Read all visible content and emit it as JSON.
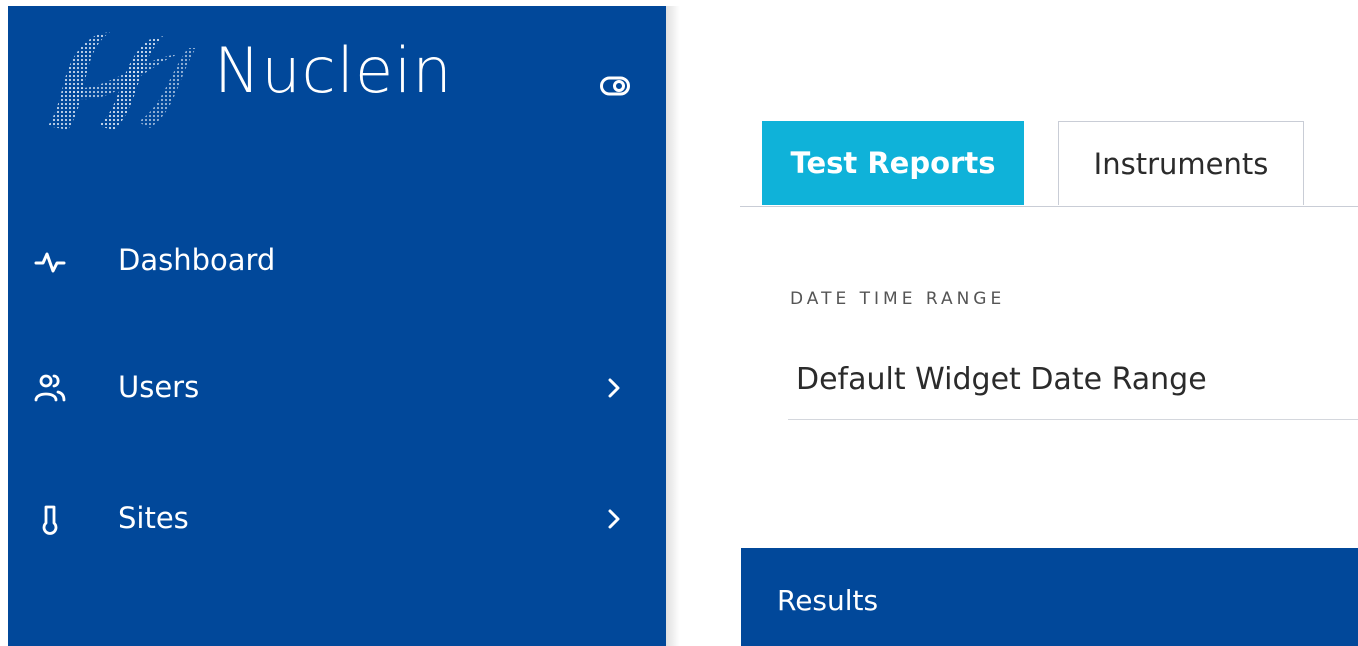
{
  "brand": {
    "name": "Nuclein",
    "logo_icon": "dna-helix-logo",
    "toggle_icon": "toggle-eye-icon"
  },
  "sidebar": {
    "items": [
      {
        "label": "Dashboard",
        "icon": "activity-pulse-icon",
        "has_submenu": false
      },
      {
        "label": "Users",
        "icon": "users-icon",
        "has_submenu": true
      },
      {
        "label": "Sites",
        "icon": "thermometer-icon",
        "has_submenu": true
      }
    ]
  },
  "tabs": [
    {
      "label": "Test Reports",
      "active": true
    },
    {
      "label": "Instruments",
      "active": false
    }
  ],
  "date_range": {
    "label": "DATE TIME RANGE",
    "value": "Default Widget Date Range"
  },
  "results": {
    "title": "Results"
  },
  "colors": {
    "sidebar_bg": "#01489a",
    "active_tab": "#0fb2d9",
    "results_bar": "#01489a"
  }
}
